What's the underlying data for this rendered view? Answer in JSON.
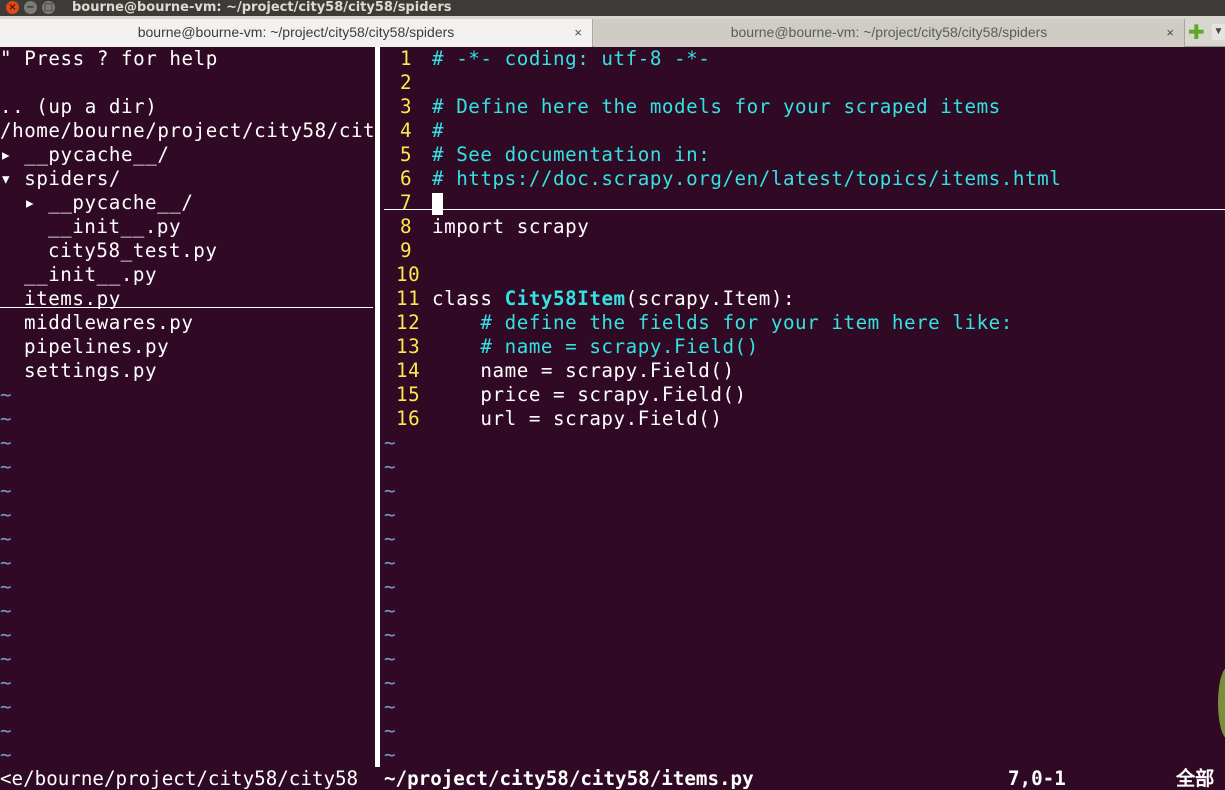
{
  "window": {
    "title": "bourne@bourne-vm: ~/project/city58/city58/spiders",
    "buttons": {
      "close": "×",
      "minimize": "−",
      "maximize": "□"
    }
  },
  "tabs": [
    {
      "label": "bourne@bourne-vm: ~/project/city58/city58/spiders",
      "close": "×",
      "active": true
    },
    {
      "label": "bourne@bourne-vm: ~/project/city58/city58/spiders",
      "close": "×",
      "active": false
    }
  ],
  "tabbar": {
    "new_tab": "✚",
    "scroll": "▼"
  },
  "tree": {
    "help": "\" Press ? for help",
    "up_dir": ".. (up a dir)",
    "root": "/home/bourne/project/city58/cit",
    "items": [
      {
        "marker": "▸",
        "name": "__pycache__/"
      },
      {
        "marker": "▾",
        "name": "spiders/"
      },
      {
        "marker": "▸",
        "name": "__pycache__/"
      },
      {
        "marker": "",
        "name": "__init__.py"
      },
      {
        "marker": "",
        "name": "city58_test.py"
      },
      {
        "marker": "",
        "name": "__init__.py"
      },
      {
        "marker": "",
        "name": "items.py"
      },
      {
        "marker": "",
        "name": "middlewares.py"
      },
      {
        "marker": "",
        "name": "pipelines.py"
      },
      {
        "marker": "",
        "name": "settings.py"
      }
    ],
    "tilde": "~"
  },
  "editor": {
    "line_numbers": [
      "1",
      "2",
      "3",
      "4",
      "5",
      "6",
      "7",
      "8",
      "9",
      "10",
      "11",
      "12",
      "13",
      "14",
      "15",
      "16"
    ],
    "lines": {
      "l1": "# -*- coding: utf-8 -*-",
      "l3": "# Define here the models for your scraped items",
      "l4": "#",
      "l5": "# See documentation in:",
      "l6": "# https://doc.scrapy.org/en/latest/topics/items.html",
      "l8_kw": "import",
      "l8_rest": " scrapy",
      "l11_kw": "class",
      "l11_name": "City58Item",
      "l11_rest": "(scrapy.Item):",
      "l12": "    # define the fields for your item here like:",
      "l13": "    # name = scrapy.Field()",
      "l14": "    name = scrapy.Field()",
      "l15": "    price = scrapy.Field()",
      "l16": "    url = scrapy.Field()"
    },
    "tilde": "~"
  },
  "status": {
    "left": "<e/bourne/project/city58/city58",
    "file": "~/project/city58/city58/items.py",
    "position": "7,0-1",
    "percent": "全部"
  },
  "colors": {
    "background": "#300a24",
    "comment": "#34e2e2",
    "line_number": "#fce94f",
    "tilde": "#729fcf"
  }
}
